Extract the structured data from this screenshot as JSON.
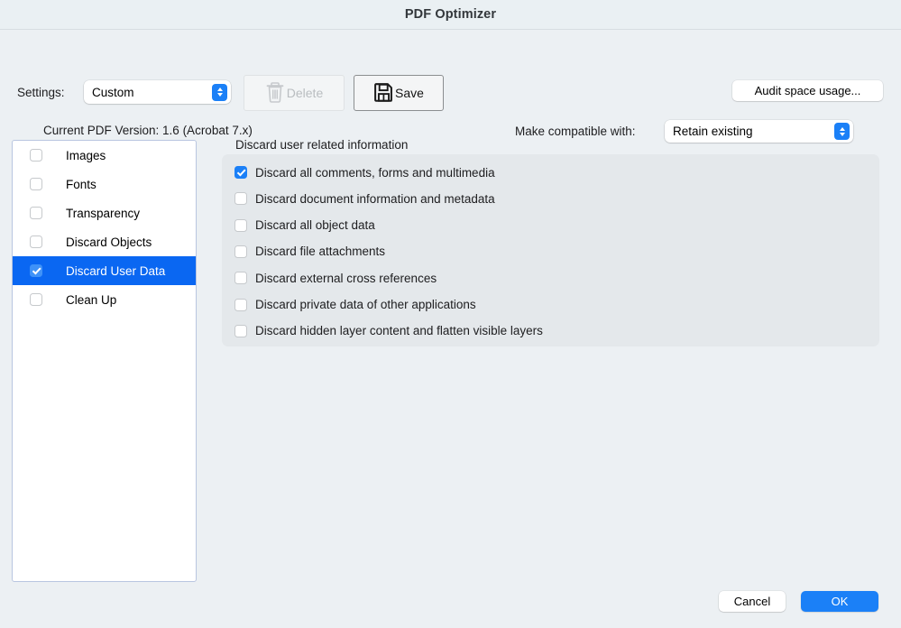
{
  "window": {
    "title": "PDF Optimizer",
    "background_color": "#ecf0f3",
    "accent_color": "#1b80f7"
  },
  "toolbar": {
    "settings_label": "Settings:",
    "settings_value": "Custom",
    "delete_label": "Delete",
    "delete_icon": "trash-icon",
    "delete_enabled": false,
    "save_label": "Save",
    "save_icon": "floppy-disk-icon",
    "audit_label": "Audit space usage...",
    "pdf_version_text": "Current PDF Version: 1.6 (Acrobat 7.x)",
    "compatible_label": "Make compatible with:",
    "compatible_value": "Retain existing"
  },
  "sidebar": {
    "items": [
      {
        "label": "Images",
        "checked": false,
        "selected": false
      },
      {
        "label": "Fonts",
        "checked": false,
        "selected": false
      },
      {
        "label": "Transparency",
        "checked": false,
        "selected": false
      },
      {
        "label": "Discard Objects",
        "checked": false,
        "selected": false
      },
      {
        "label": "Discard User Data",
        "checked": true,
        "selected": true
      },
      {
        "label": "Clean Up",
        "checked": false,
        "selected": false
      }
    ]
  },
  "panel": {
    "group_title": "Discard user related information",
    "options": [
      {
        "label": "Discard all comments, forms and multimedia",
        "checked": true
      },
      {
        "label": "Discard document information and metadata",
        "checked": false
      },
      {
        "label": "Discard all object data",
        "checked": false
      },
      {
        "label": "Discard file attachments",
        "checked": false
      },
      {
        "label": "Discard external cross references",
        "checked": false
      },
      {
        "label": "Discard private data of other applications",
        "checked": false
      },
      {
        "label": "Discard hidden layer content and flatten visible layers",
        "checked": false
      }
    ]
  },
  "footer": {
    "cancel_label": "Cancel",
    "ok_label": "OK"
  }
}
